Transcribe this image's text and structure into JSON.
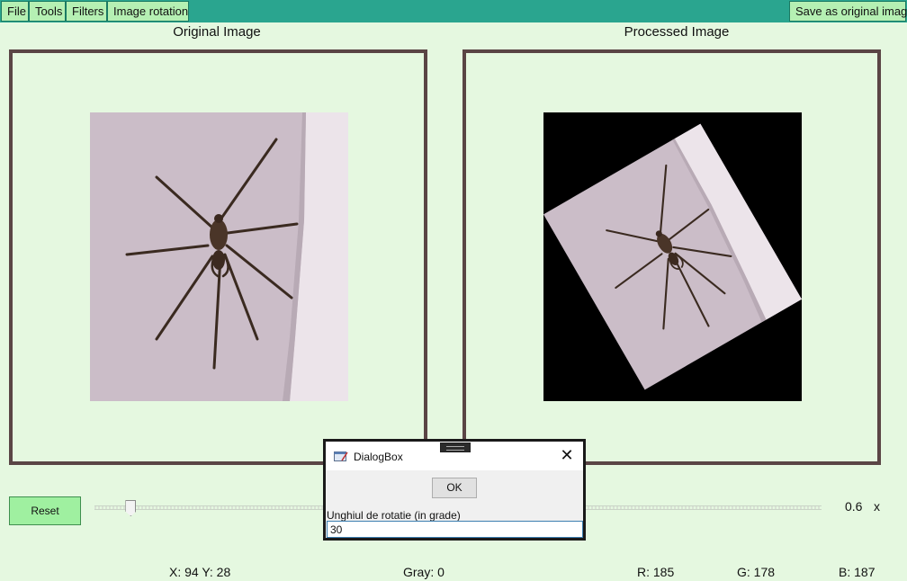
{
  "menu": {
    "items": [
      {
        "label": "File"
      },
      {
        "label": "Tools"
      },
      {
        "label": "Filters"
      },
      {
        "label": "Image rotation"
      }
    ],
    "save_label": "Save as original image"
  },
  "panels": {
    "original_title": "Original Image",
    "processed_title": "Processed Image",
    "rotation_degrees": 30
  },
  "controls": {
    "reset_label": "Reset",
    "zoom_value": "0.6",
    "zoom_suffix": "x",
    "zoom_slider_fraction": 0.05
  },
  "status": {
    "coords": "X: 94 Y: 28",
    "gray": "Gray: 0",
    "r": "R: 185",
    "g": "G: 178",
    "b": "B: 187"
  },
  "dialog": {
    "title": "DialogBox",
    "ok_label": "OK",
    "prompt": "Unghiul de rotatie (in grade)",
    "input_value": "30"
  },
  "colors": {
    "background": "#e5f8e0",
    "topbar": "#2aa58f",
    "button": "#b5f0b3",
    "frame_border": "#5a4545"
  }
}
